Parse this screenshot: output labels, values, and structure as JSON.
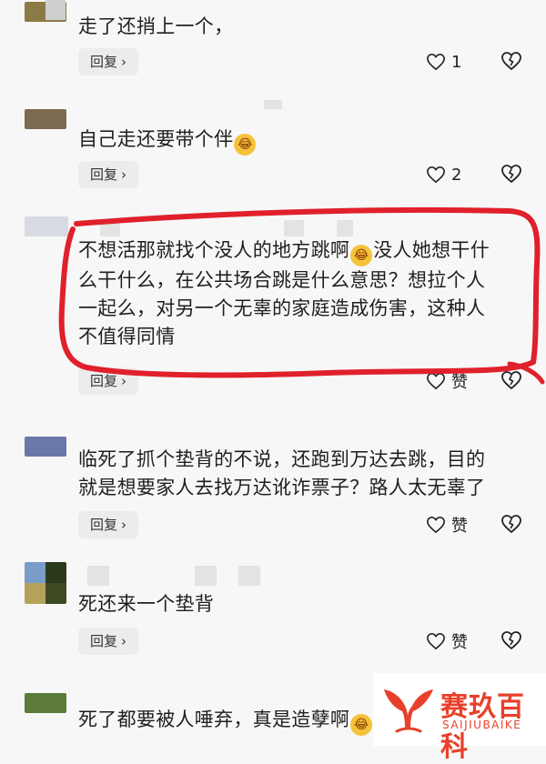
{
  "comments": [
    {
      "text": "走了还捎上一个，",
      "reply_label": "回复",
      "like_count": "1",
      "avatar_color": "#8a7a45"
    },
    {
      "text_before_emoji": "自己走还要带个伴",
      "text_after_emoji": "",
      "reply_label": "回复",
      "like_count": "2",
      "avatar_color": "#7b6a50"
    },
    {
      "lines": [
        "不想活那就找个没人的地方跳啊",
        "么干什么，在公共场合跳是什么意思？想拉个人",
        "一起么，对另一个无辜的家庭造成伤害，这种人",
        "不值得同情"
      ],
      "line1_after_emoji": "没人她想干什",
      "reply_label": "回复",
      "like_count": "赞",
      "avatar_color": "#d9dbe2",
      "highlight_color": "#e0202b"
    },
    {
      "lines": [
        "临死了抓个垫背的不说，还跑到万达去跳，目的",
        "就是想要家人去找万达讹诈票子？路人太无辜了"
      ],
      "reply_label": "回复",
      "like_count": "赞",
      "avatar_color": "#6a78a8"
    },
    {
      "text": "死还来一个垫背",
      "reply_label": "回复",
      "like_count": "赞",
      "avatar_color": "#3b4a2a"
    },
    {
      "text_before_emoji": "死了都要被人唾弃，真是造孽啊",
      "avatar_color": "#5c7a3a"
    }
  ],
  "reply_chevron": "›",
  "emoji": {
    "name": "laughing-crying-emoji",
    "glyph": "😂"
  },
  "watermark": {
    "cn": "赛玖百科",
    "en": "SAIJIUBAIKE",
    "color": "#e8402a"
  }
}
